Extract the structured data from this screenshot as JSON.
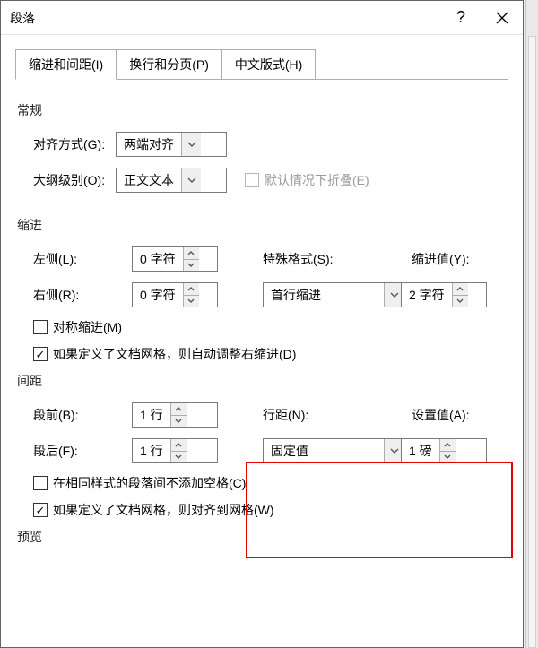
{
  "dialog": {
    "title": "段落",
    "help_icon": "?",
    "tabs": {
      "indent_spacing": "缩进和间距(I)",
      "line_page_breaks": "换行和分页(P)",
      "asian_typography": "中文版式(H)"
    }
  },
  "general": {
    "section": "常规",
    "alignment_label": "对齐方式(G):",
    "alignment_value": "两端对齐",
    "outline_label": "大纲级别(O):",
    "outline_value": "正文文本",
    "collapsed_label": "默认情况下折叠(E)"
  },
  "indentation": {
    "section": "缩进",
    "left_label": "左侧(L):",
    "left_value": "0 字符",
    "right_label": "右侧(R):",
    "right_value": "0 字符",
    "special_label": "特殊格式(S):",
    "special_value": "首行缩进",
    "by_label": "缩进值(Y):",
    "by_value": "2 字符",
    "mirror_label": "对称缩进(M)",
    "auto_adjust_label": "如果定义了文档网格，则自动调整右缩进(D)"
  },
  "spacing": {
    "section": "间距",
    "before_label": "段前(B):",
    "before_value": "1 行",
    "after_label": "段后(F):",
    "after_value": "1 行",
    "line_spacing_label": "行距(N):",
    "line_spacing_value": "固定值",
    "at_label": "设置值(A):",
    "at_value": "1 磅",
    "no_space_label": "在相同样式的段落间不添加空格(C)",
    "snap_grid_label": "如果定义了文档网格，则对齐到网格(W)"
  },
  "preview": {
    "section": "预览"
  }
}
